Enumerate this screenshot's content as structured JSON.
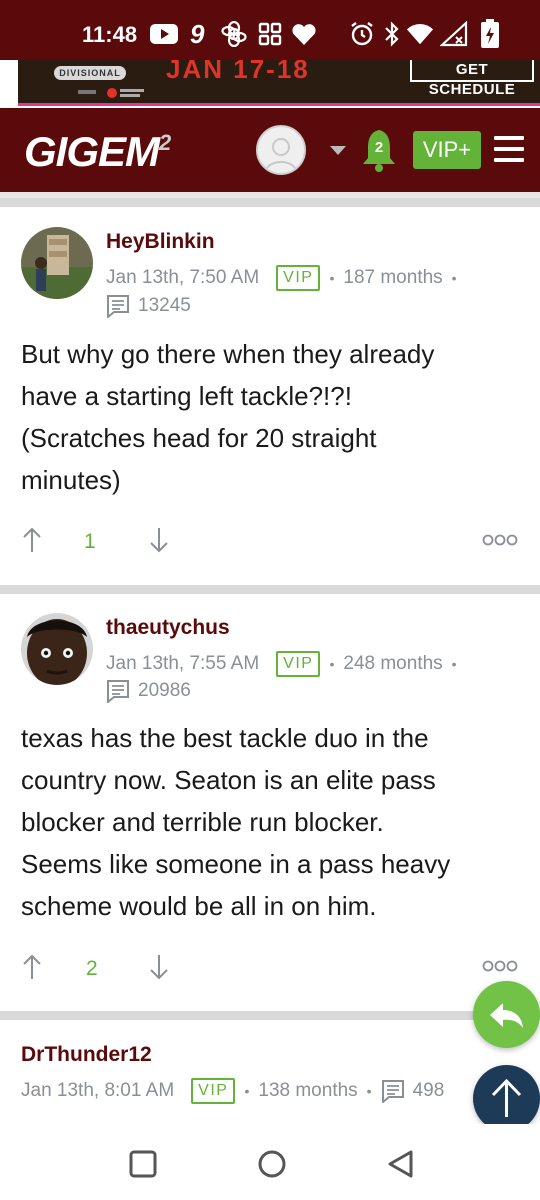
{
  "status_bar": {
    "time": "11:48",
    "icons": [
      "youtube-icon",
      "app-9-icon",
      "openai-icon",
      "grid-app-icon",
      "heart-icon",
      "alarm-icon",
      "bluetooth-icon",
      "wifi-icon",
      "signal-icon",
      "battery-icon"
    ]
  },
  "ad": {
    "badge": "DIVISIONAL",
    "dates": "JAN 17-18",
    "cta": "GET SCHEDULE"
  },
  "header": {
    "logo": "GIGEM",
    "logo_sup": "2",
    "notification_count": "2",
    "vip_button": "VIP+",
    "colors": {
      "maroon": "#5a0a0a",
      "green": "#63b338"
    }
  },
  "posts": [
    {
      "username": "HeyBlinkin",
      "date": "Jan 13th, 7:50 AM",
      "badge": "VIP",
      "tenure": "187 months",
      "post_count": "13245",
      "body_lines": [
        "But why go there when they already",
        "have a starting left tackle?!?!",
        "(Scratches head for 20 straight",
        "minutes)"
      ],
      "votes": "1"
    },
    {
      "username": "thaeutychus",
      "date": "Jan 13th, 7:55 AM",
      "badge": "VIP",
      "tenure": "248 months",
      "post_count": "20986",
      "body_lines": [
        "texas has the best tackle duo in the",
        "country now. Seaton is an elite pass",
        "blocker and terrible run blocker.",
        "Seems like someone in a pass heavy",
        "scheme would be all in on him."
      ],
      "votes": "2"
    },
    {
      "username": "DrThunder12",
      "date": "Jan 13th, 8:01 AM",
      "badge": "VIP",
      "tenure": "138 months",
      "post_count": "498"
    }
  ]
}
